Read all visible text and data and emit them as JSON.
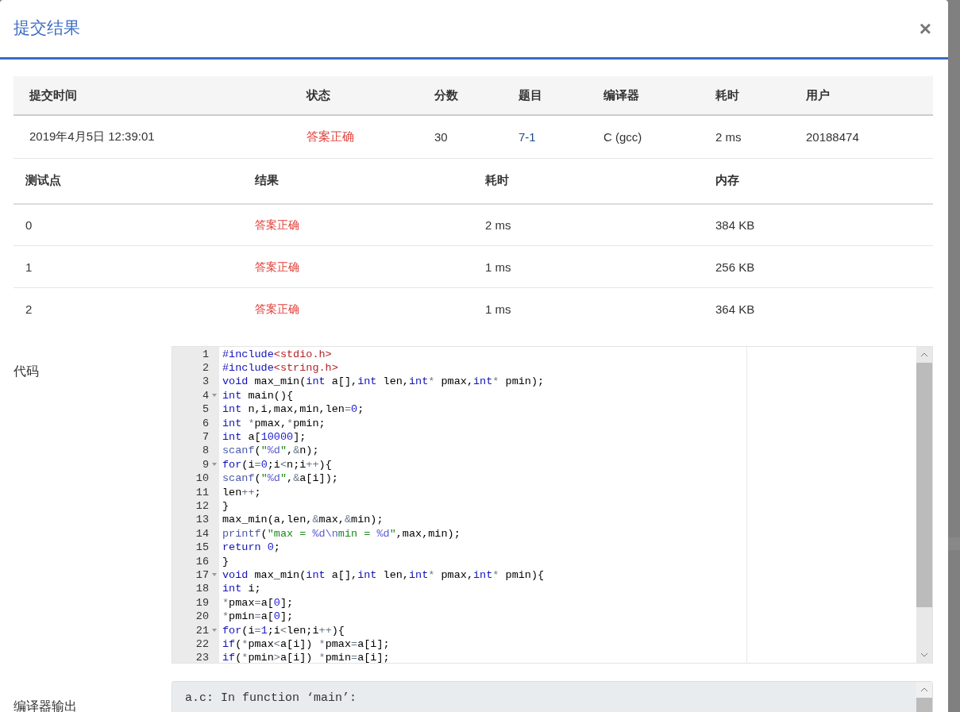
{
  "dialog": {
    "title": "提交结果",
    "close": "×"
  },
  "submission": {
    "columns": [
      "提交时间",
      "状态",
      "分数",
      "题目",
      "编译器",
      "耗时",
      "用户"
    ],
    "row": [
      {
        "text": "2019年4月5日 12:39:01",
        "kind": "plain"
      },
      {
        "text": "答案正确",
        "kind": "status"
      },
      {
        "text": "30",
        "kind": "plain"
      },
      {
        "text": "7-1",
        "kind": "link"
      },
      {
        "text": "C (gcc)",
        "kind": "plain"
      },
      {
        "text": "2 ms",
        "kind": "plain"
      },
      {
        "text": "20188474",
        "kind": "plain"
      }
    ]
  },
  "tests": {
    "columns": [
      "测试点",
      "结果",
      "耗时",
      "内存"
    ],
    "rows": [
      {
        "cells": [
          "0",
          "答案正确",
          "2 ms",
          "384 KB"
        ]
      },
      {
        "cells": [
          "1",
          "答案正确",
          "1 ms",
          "256 KB"
        ]
      },
      {
        "cells": [
          "2",
          "答案正确",
          "1 ms",
          "364 KB"
        ]
      }
    ]
  },
  "code": {
    "label": "代码",
    "lines": [
      {
        "num": "1",
        "fold": false,
        "tokens": [
          {
            "text": "#include",
            "kind": "kw"
          },
          {
            "text": "<stdio.h>",
            "kind": "inc"
          }
        ]
      },
      {
        "num": "2",
        "fold": false,
        "tokens": [
          {
            "text": "#include",
            "kind": "kw"
          },
          {
            "text": "<string.h>",
            "kind": "inc"
          }
        ]
      },
      {
        "num": "3",
        "fold": false,
        "tokens": [
          {
            "text": "void",
            "kind": "kw"
          },
          {
            "text": " max_min(",
            "kind": "p"
          },
          {
            "text": "int",
            "kind": "kw"
          },
          {
            "text": " a[],",
            "kind": "p"
          },
          {
            "text": "int",
            "kind": "kw"
          },
          {
            "text": " len,",
            "kind": "p"
          },
          {
            "text": "int",
            "kind": "kw"
          },
          {
            "text": "*",
            "kind": "op"
          },
          {
            "text": " pmax,",
            "kind": "p"
          },
          {
            "text": "int",
            "kind": "kw"
          },
          {
            "text": "*",
            "kind": "op"
          },
          {
            "text": " pmin);",
            "kind": "p"
          }
        ]
      },
      {
        "num": "4",
        "fold": true,
        "tokens": [
          {
            "text": "int",
            "kind": "kw"
          },
          {
            "text": " main(){",
            "kind": "p"
          }
        ]
      },
      {
        "num": "5",
        "fold": false,
        "tokens": [
          {
            "text": "int",
            "kind": "kw"
          },
          {
            "text": " n,i,max,min,len",
            "kind": "p"
          },
          {
            "text": "=",
            "kind": "op"
          },
          {
            "text": "0",
            "kind": "num"
          },
          {
            "text": ";",
            "kind": "p"
          }
        ]
      },
      {
        "num": "6",
        "fold": false,
        "tokens": [
          {
            "text": "int",
            "kind": "kw"
          },
          {
            "text": " *",
            "kind": "op"
          },
          {
            "text": "pmax,",
            "kind": "p"
          },
          {
            "text": "*",
            "kind": "op"
          },
          {
            "text": "pmin;",
            "kind": "p"
          }
        ]
      },
      {
        "num": "7",
        "fold": false,
        "tokens": [
          {
            "text": "int",
            "kind": "kw"
          },
          {
            "text": " a[",
            "kind": "p"
          },
          {
            "text": "10000",
            "kind": "num"
          },
          {
            "text": "];",
            "kind": "p"
          }
        ]
      },
      {
        "num": "8",
        "fold": false,
        "tokens": [
          {
            "text": "scanf",
            "kind": "fn"
          },
          {
            "text": "(",
            "kind": "p"
          },
          {
            "text": "\"",
            "kind": "str"
          },
          {
            "text": "%d",
            "kind": "fmt"
          },
          {
            "text": "\"",
            "kind": "str"
          },
          {
            "text": ",",
            "kind": "p"
          },
          {
            "text": "&",
            "kind": "op"
          },
          {
            "text": "n);",
            "kind": "p"
          }
        ]
      },
      {
        "num": "9",
        "fold": true,
        "tokens": [
          {
            "text": "for",
            "kind": "kw"
          },
          {
            "text": "(i",
            "kind": "p"
          },
          {
            "text": "=",
            "kind": "op"
          },
          {
            "text": "0",
            "kind": "num"
          },
          {
            "text": ";i",
            "kind": "p"
          },
          {
            "text": "<",
            "kind": "op"
          },
          {
            "text": "n;i",
            "kind": "p"
          },
          {
            "text": "++",
            "kind": "op"
          },
          {
            "text": "){",
            "kind": "p"
          }
        ]
      },
      {
        "num": "10",
        "fold": false,
        "tokens": [
          {
            "text": "scanf",
            "kind": "fn"
          },
          {
            "text": "(",
            "kind": "p"
          },
          {
            "text": "\"",
            "kind": "str"
          },
          {
            "text": "%d",
            "kind": "fmt"
          },
          {
            "text": "\"",
            "kind": "str"
          },
          {
            "text": ",",
            "kind": "p"
          },
          {
            "text": "&",
            "kind": "op"
          },
          {
            "text": "a[i]);",
            "kind": "p"
          }
        ]
      },
      {
        "num": "11",
        "fold": false,
        "tokens": [
          {
            "text": "len",
            "kind": "p"
          },
          {
            "text": "++",
            "kind": "op"
          },
          {
            "text": ";",
            "kind": "p"
          }
        ]
      },
      {
        "num": "12",
        "fold": false,
        "tokens": [
          {
            "text": "}",
            "kind": "p"
          }
        ]
      },
      {
        "num": "13",
        "fold": false,
        "tokens": [
          {
            "text": "max_min(a,len,",
            "kind": "p"
          },
          {
            "text": "&",
            "kind": "op"
          },
          {
            "text": "max,",
            "kind": "p"
          },
          {
            "text": "&",
            "kind": "op"
          },
          {
            "text": "min);",
            "kind": "p"
          }
        ]
      },
      {
        "num": "14",
        "fold": false,
        "tokens": [
          {
            "text": "printf",
            "kind": "fn"
          },
          {
            "text": "(",
            "kind": "p"
          },
          {
            "text": "\"max = ",
            "kind": "str"
          },
          {
            "text": "%d",
            "kind": "fmt"
          },
          {
            "text": "\\n",
            "kind": "fmt"
          },
          {
            "text": "min = ",
            "kind": "str"
          },
          {
            "text": "%d",
            "kind": "fmt"
          },
          {
            "text": "\"",
            "kind": "str"
          },
          {
            "text": ",max,min);",
            "kind": "p"
          }
        ]
      },
      {
        "num": "15",
        "fold": false,
        "tokens": [
          {
            "text": "return",
            "kind": "kw"
          },
          {
            "text": " 0",
            "kind": "num"
          },
          {
            "text": ";",
            "kind": "p"
          }
        ]
      },
      {
        "num": "16",
        "fold": false,
        "tokens": [
          {
            "text": "}",
            "kind": "p"
          }
        ]
      },
      {
        "num": "17",
        "fold": true,
        "tokens": [
          {
            "text": "void",
            "kind": "kw"
          },
          {
            "text": " max_min(",
            "kind": "p"
          },
          {
            "text": "int",
            "kind": "kw"
          },
          {
            "text": " a[],",
            "kind": "p"
          },
          {
            "text": "int",
            "kind": "kw"
          },
          {
            "text": " len,",
            "kind": "p"
          },
          {
            "text": "int",
            "kind": "kw"
          },
          {
            "text": "*",
            "kind": "op"
          },
          {
            "text": " pmax,",
            "kind": "p"
          },
          {
            "text": "int",
            "kind": "kw"
          },
          {
            "text": "*",
            "kind": "op"
          },
          {
            "text": " pmin){",
            "kind": "p"
          }
        ]
      },
      {
        "num": "18",
        "fold": false,
        "tokens": [
          {
            "text": "int",
            "kind": "kw"
          },
          {
            "text": " i;",
            "kind": "p"
          }
        ]
      },
      {
        "num": "19",
        "fold": false,
        "tokens": [
          {
            "text": "*",
            "kind": "op"
          },
          {
            "text": "pmax",
            "kind": "p"
          },
          {
            "text": "=",
            "kind": "op"
          },
          {
            "text": "a[",
            "kind": "p"
          },
          {
            "text": "0",
            "kind": "num"
          },
          {
            "text": "];",
            "kind": "p"
          }
        ]
      },
      {
        "num": "20",
        "fold": false,
        "tokens": [
          {
            "text": "*",
            "kind": "op"
          },
          {
            "text": "pmin",
            "kind": "p"
          },
          {
            "text": "=",
            "kind": "op"
          },
          {
            "text": "a[",
            "kind": "p"
          },
          {
            "text": "0",
            "kind": "num"
          },
          {
            "text": "];",
            "kind": "p"
          }
        ]
      },
      {
        "num": "21",
        "fold": true,
        "tokens": [
          {
            "text": "for",
            "kind": "kw"
          },
          {
            "text": "(i",
            "kind": "p"
          },
          {
            "text": "=",
            "kind": "op"
          },
          {
            "text": "1",
            "kind": "num"
          },
          {
            "text": ";i",
            "kind": "p"
          },
          {
            "text": "<",
            "kind": "op"
          },
          {
            "text": "len;i",
            "kind": "p"
          },
          {
            "text": "++",
            "kind": "op"
          },
          {
            "text": "){",
            "kind": "p"
          }
        ]
      },
      {
        "num": "22",
        "fold": false,
        "tokens": [
          {
            "text": "if",
            "kind": "kw"
          },
          {
            "text": "(",
            "kind": "p"
          },
          {
            "text": "*",
            "kind": "op"
          },
          {
            "text": "pmax",
            "kind": "p"
          },
          {
            "text": "<",
            "kind": "op"
          },
          {
            "text": "a[i]) ",
            "kind": "p"
          },
          {
            "text": "*",
            "kind": "op"
          },
          {
            "text": "pmax",
            "kind": "p"
          },
          {
            "text": "=",
            "kind": "op"
          },
          {
            "text": "a[i];",
            "kind": "p"
          }
        ]
      },
      {
        "num": "23",
        "fold": false,
        "tokens": [
          {
            "text": "if",
            "kind": "kw"
          },
          {
            "text": "(",
            "kind": "p"
          },
          {
            "text": "*",
            "kind": "op"
          },
          {
            "text": "pmin",
            "kind": "p"
          },
          {
            "text": ">",
            "kind": "op"
          },
          {
            "text": "a[i]) ",
            "kind": "p"
          },
          {
            "text": "*",
            "kind": "op"
          },
          {
            "text": "pmin",
            "kind": "p"
          },
          {
            "text": "=",
            "kind": "op"
          },
          {
            "text": "a[i];",
            "kind": "p"
          }
        ]
      }
    ]
  },
  "compiler_output": {
    "label": "编译器输出",
    "text": "a.c: In function ‘main’:"
  }
}
